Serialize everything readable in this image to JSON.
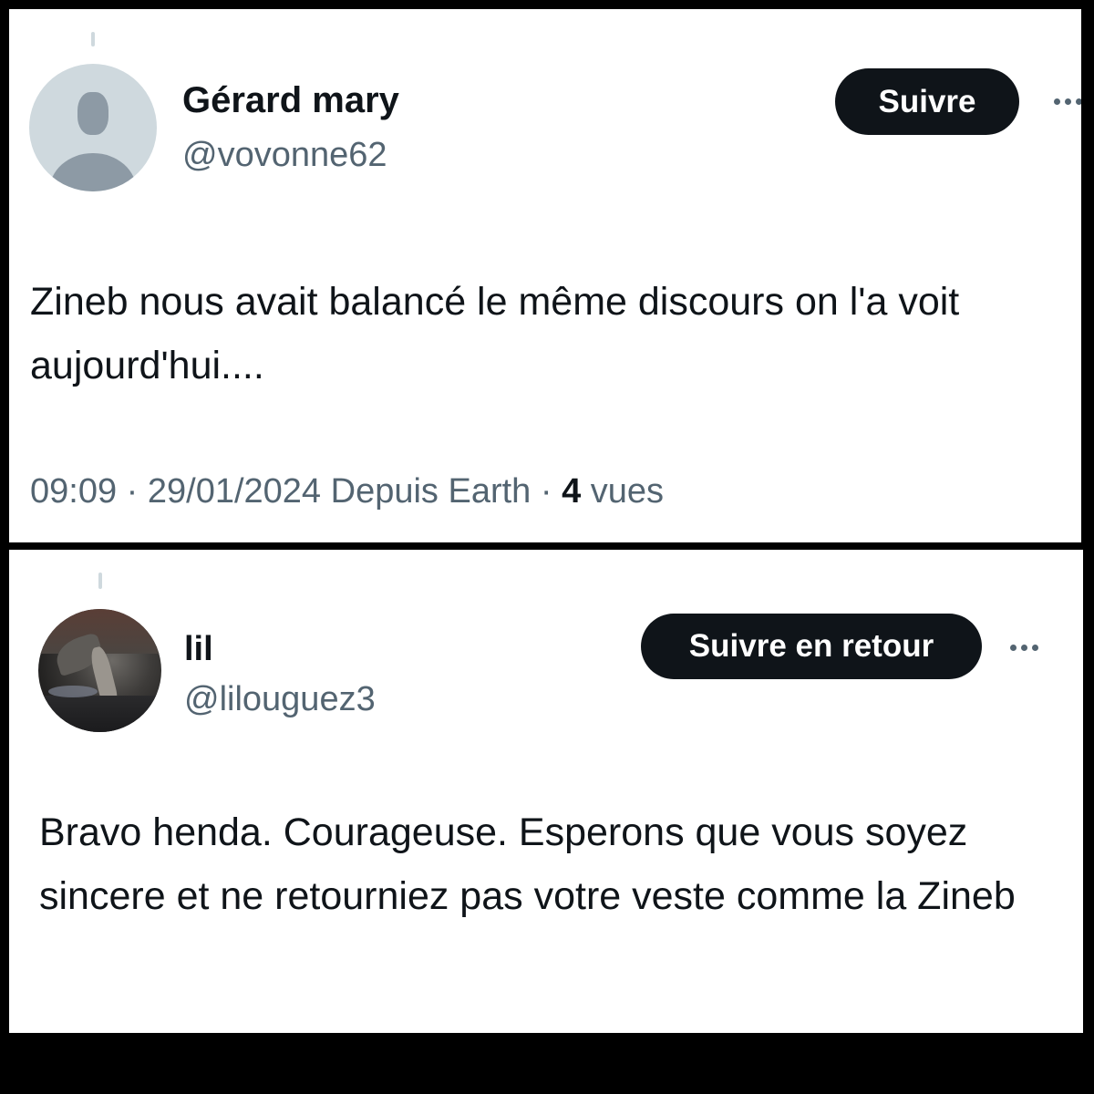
{
  "tweets": [
    {
      "display_name": "Gérard mary",
      "handle": "@vovonne62",
      "follow_label": "Suivre",
      "text": "Zineb nous avait balancé le même discours on l'a voit aujourd'hui....",
      "time": "09:09",
      "separator": "·",
      "date": "29/01/2024",
      "source": "Depuis Earth",
      "views_count": "4",
      "views_label": "vues",
      "avatar_icon": "default-profile-icon"
    },
    {
      "display_name": "lil",
      "handle": "@lilouguez3",
      "follow_label": "Suivre en retour",
      "text": "Bravo henda. Courageuse. Esperons que vous soyez sincere et ne retourniez pas votre veste comme la Zineb",
      "avatar_icon": "profile-photo"
    }
  ],
  "colors": {
    "frame": "#000000",
    "card": "#ffffff",
    "primary_text": "#0f1419",
    "secondary_text": "#536471",
    "button_bg": "#0f1419",
    "button_text": "#ffffff",
    "thread_line": "#cfd9de"
  },
  "icons": {
    "more": "more-options-icon"
  }
}
